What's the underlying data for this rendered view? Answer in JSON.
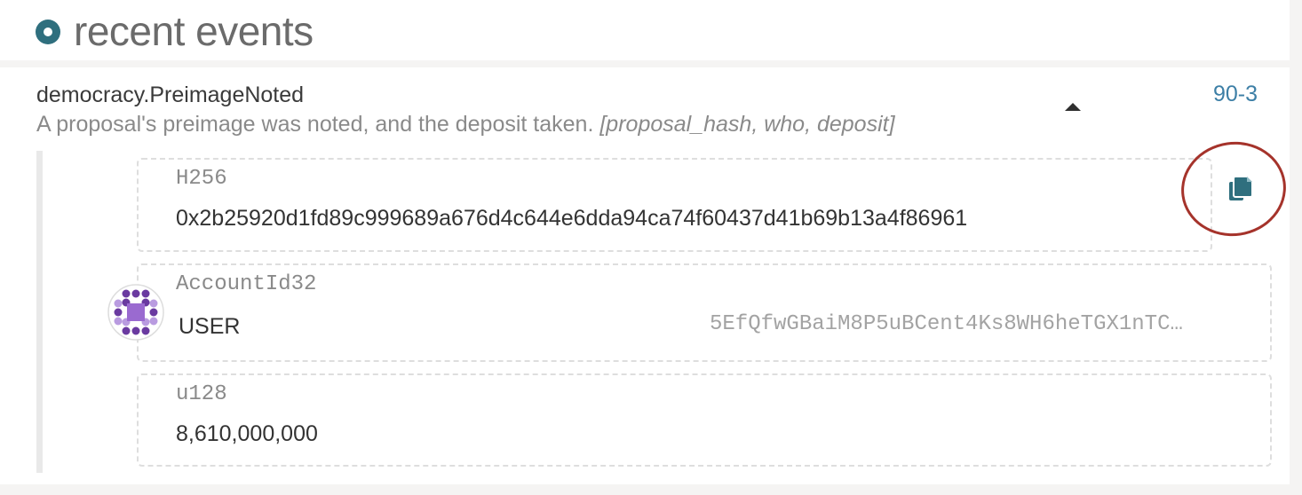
{
  "header": {
    "title": "recent events"
  },
  "event": {
    "name": "democracy.PreimageNoted",
    "description": "A proposal's preimage was noted, and the deposit taken.",
    "params_signature": "[proposal_hash, who, deposit]",
    "block_ref": "90-3",
    "params": [
      {
        "type": "H256",
        "value": "0x2b25920d1fd89c999689a676d4c644e6dda94ca74f60437d41b69b13a4f86961"
      },
      {
        "type": "AccountId32",
        "account_name": "USER",
        "address": "5EfQfwGBaiM8P5uBCent4Ks8WH6heTGX1nTC…"
      },
      {
        "type": "u128",
        "value": "8,610,000,000"
      }
    ]
  },
  "colors": {
    "accent": "#2f6f7e",
    "link": "#3d7fa6",
    "highlight": "#a5332b",
    "avatar_primary": "#6a3aa0",
    "avatar_secondary": "#b99be0"
  },
  "icons": {
    "header_bullet": "bullet-icon",
    "collapse": "caret-up-icon",
    "copy": "copy-icon",
    "identity": "identicon"
  }
}
